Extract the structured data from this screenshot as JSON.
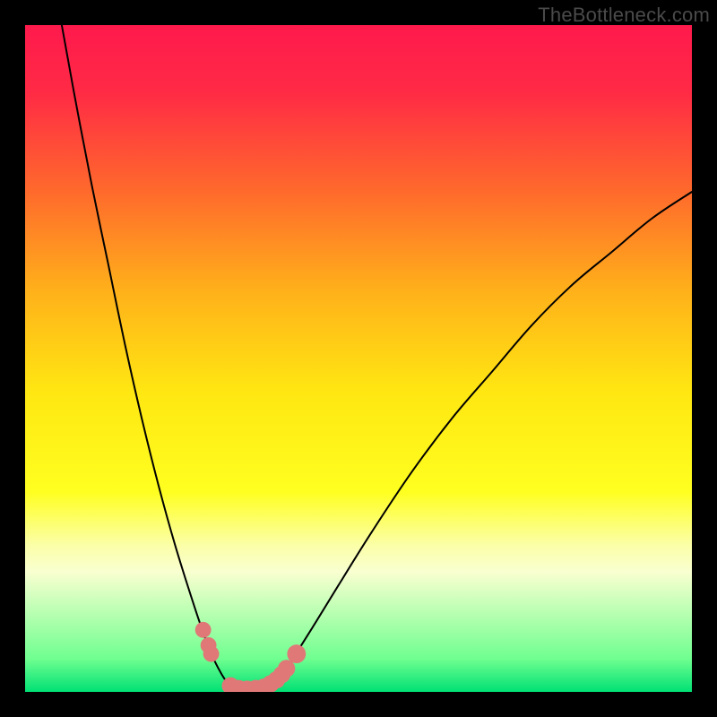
{
  "watermark": "TheBottleneck.com",
  "chart_data": {
    "type": "line",
    "title": "",
    "xlabel": "",
    "ylabel": "",
    "xlim": [
      0,
      100
    ],
    "ylim": [
      0,
      100
    ],
    "grid": false,
    "legend": false,
    "background": {
      "type": "vertical-gradient",
      "stops": [
        {
          "pos": 0.0,
          "color": "#ff1a4d"
        },
        {
          "pos": 0.1,
          "color": "#ff2a45"
        },
        {
          "pos": 0.25,
          "color": "#ff6a2c"
        },
        {
          "pos": 0.4,
          "color": "#ffb11a"
        },
        {
          "pos": 0.55,
          "color": "#ffe712"
        },
        {
          "pos": 0.7,
          "color": "#ffff20"
        },
        {
          "pos": 0.78,
          "color": "#fbffa8"
        },
        {
          "pos": 0.82,
          "color": "#f9ffd0"
        },
        {
          "pos": 0.95,
          "color": "#70ff90"
        },
        {
          "pos": 1.0,
          "color": "#00e074"
        }
      ]
    },
    "series": [
      {
        "name": "left-curve",
        "x": [
          5.5,
          7.5,
          10,
          12.5,
          15,
          17.5,
          20,
          22.5,
          25,
          26.5,
          27.8,
          29,
          30,
          30.8
        ],
        "y": [
          100,
          89,
          76,
          64,
          52,
          41,
          31,
          22,
          14,
          9.5,
          6,
          3.5,
          1.8,
          0.8
        ]
      },
      {
        "name": "right-curve",
        "x": [
          36.5,
          38,
          40,
          43,
          47,
          52,
          58,
          64,
          70,
          76,
          82,
          88,
          94,
          100
        ],
        "y": [
          0.8,
          2,
          4.8,
          9.5,
          16,
          24,
          33,
          41,
          48,
          55,
          61,
          66,
          71,
          75
        ]
      },
      {
        "name": "valley-floor",
        "x": [
          30.8,
          32,
          33.5,
          35,
          36.5
        ],
        "y": [
          0.8,
          0.4,
          0.3,
          0.4,
          0.8
        ]
      }
    ],
    "markers": {
      "name": "highlighted-points",
      "color": "#e07878",
      "points": [
        {
          "x": 26.7,
          "y": 9.3,
          "r": 1.2
        },
        {
          "x": 27.5,
          "y": 7.0,
          "r": 1.2
        },
        {
          "x": 27.9,
          "y": 5.7,
          "r": 1.2
        },
        {
          "x": 30.8,
          "y": 0.9,
          "r": 1.3
        },
        {
          "x": 32.0,
          "y": 0.5,
          "r": 1.3
        },
        {
          "x": 33.3,
          "y": 0.4,
          "r": 1.3
        },
        {
          "x": 34.6,
          "y": 0.5,
          "r": 1.3
        },
        {
          "x": 35.8,
          "y": 0.7,
          "r": 1.3
        },
        {
          "x": 36.8,
          "y": 1.2,
          "r": 1.3
        },
        {
          "x": 37.7,
          "y": 1.8,
          "r": 1.3
        },
        {
          "x": 38.5,
          "y": 2.6,
          "r": 1.3
        },
        {
          "x": 39.2,
          "y": 3.5,
          "r": 1.3
        },
        {
          "x": 40.7,
          "y": 5.7,
          "r": 1.4
        }
      ]
    }
  }
}
